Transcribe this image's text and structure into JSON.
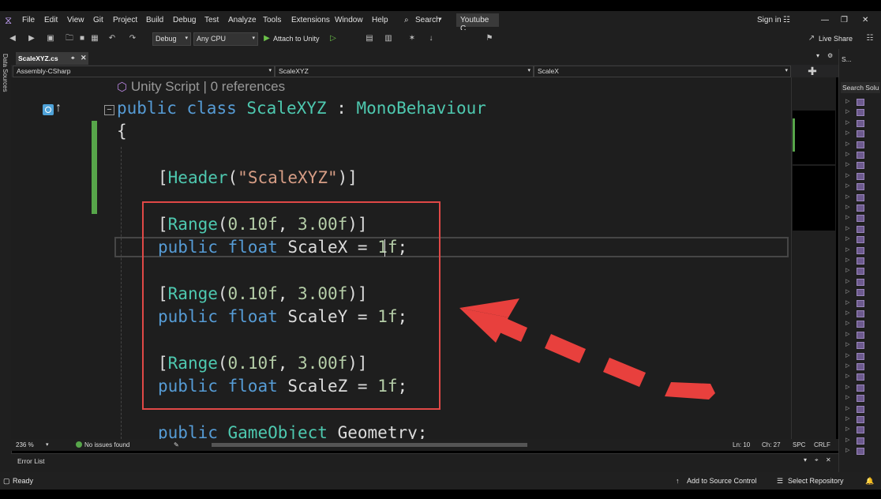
{
  "menu": {
    "items": [
      "File",
      "Edit",
      "View",
      "Git",
      "Project",
      "Build",
      "Debug",
      "Test",
      "Analyze",
      "Tools",
      "Extensions",
      "Window",
      "Help"
    ],
    "search_label": "Search",
    "window_title": "Youtube C_",
    "sign_in": "Sign in"
  },
  "toolbar": {
    "config": "Debug",
    "platform": "Any CPU",
    "attach_label": "Attach to Unity",
    "live_share": "Live Share"
  },
  "left_strip": {
    "label": "Data Sources"
  },
  "tabs": [
    {
      "label": "ScaleXYZ.cs"
    }
  ],
  "navbar": {
    "project": "Assembly-CSharp",
    "type": "ScaleXYZ",
    "member": "ScaleX"
  },
  "editor": {
    "codelens": "Unity Script | 0 references",
    "lines": {
      "class_decl": [
        "public",
        "class",
        "ScaleXYZ",
        ":",
        "MonoBehaviour"
      ],
      "open_brace": "{",
      "header_attr": [
        "[",
        "Header",
        "(",
        "\"ScaleXYZ\"",
        ")]"
      ],
      "range_attr": [
        "[",
        "Range",
        "(",
        "0.10f",
        ", ",
        "3.00f",
        ")]"
      ],
      "fields": [
        {
          "kw1": "public",
          "kw2": "float",
          "name": "ScaleX",
          "eq": " = ",
          "value": "1f",
          "end": ";"
        },
        {
          "kw1": "public",
          "kw2": "float",
          "name": "ScaleY",
          "eq": " = ",
          "value": "1f",
          "end": ";"
        },
        {
          "kw1": "public",
          "kw2": "float",
          "name": "ScaleZ",
          "eq": " = ",
          "value": "1f",
          "end": ";"
        }
      ],
      "geometry": {
        "kw1": "public",
        "type": "GameObject",
        "name": "Geometry;"
      }
    }
  },
  "editor_status": {
    "zoom": "236 %",
    "issues": "No issues found",
    "line": "Ln: 10",
    "col": "Ch: 27",
    "spc": "SPC",
    "eol": "CRLF"
  },
  "error_list": {
    "title": "Error List"
  },
  "solution": {
    "header": "S...",
    "search": "Search Solu"
  },
  "statusbar": {
    "ready": "Ready",
    "add_source": "Add to Source Control",
    "select_repo": "Select Repository"
  },
  "colors": {
    "accent": "#5a76c6",
    "highlight_box": "#e04846",
    "arrow": "#e8403d",
    "change_bar": "#57a64a"
  }
}
